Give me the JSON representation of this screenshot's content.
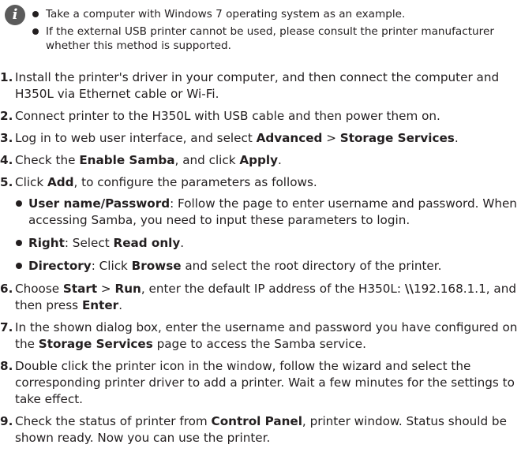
{
  "note": {
    "icon": "info-icon",
    "icon_glyph": "i",
    "items": [
      "Take a computer with Windows 7 operating system as an example.",
      "If the external USB printer cannot be used, please consult the printer manufacturer whether this method is supported."
    ]
  },
  "steps": [
    {
      "num": "1.",
      "text": "Install the printer's driver in your computer, and then connect the computer and H350L via Ethernet cable or Wi-Fi."
    },
    {
      "num": "2.",
      "text": "Connect printer to the H350L with USB cable and then power them on."
    },
    {
      "num": "3.",
      "t1": "Log in to web user interface, and select ",
      "b1": "Advanced",
      "t2": " > ",
      "b2": "Storage Services",
      "t3": "."
    },
    {
      "num": "4.",
      "t1": "Check the ",
      "b1": "Enable Samba",
      "t2": ", and click ",
      "b2": "Apply",
      "t3": "."
    },
    {
      "num": "5.",
      "t1": "Click ",
      "b1": "Add",
      "t2": ", to configure the parameters as follows.",
      "sub": [
        {
          "b1": "User name/Password",
          "t1": ": Follow the page to enter username and password. When accessing Samba, you need to input these parameters to login."
        },
        {
          "b1": "Right",
          "t1": ": Select ",
          "b2": "Read only",
          "t2": "."
        },
        {
          "b1": "Directory",
          "t1": ": Click ",
          "b2": "Browse",
          "t2": " and select the root directory of the printer."
        }
      ]
    },
    {
      "num": "6.",
      "t1": "Choose ",
      "b1": "Start",
      "t2": " > ",
      "b2": "Run",
      "t3": ", enter the default IP address of the H350L: ",
      "b3": "\\\\",
      "t4": "192.168.1.1, and then press ",
      "b4": "Enter",
      "t5": "."
    },
    {
      "num": "7.",
      "t1": "In the shown dialog box, enter the username and password you have configured on the ",
      "b1": "Storage Services",
      "t2": " page to access the Samba service."
    },
    {
      "num": "8.",
      "text": "Double click the printer icon in the window, follow the wizard and select the corresponding printer driver to add a printer. Wait a few minutes for the settings to take effect."
    },
    {
      "num": "9.",
      "t1": "Check the status of printer from ",
      "b1": "Control Panel",
      "t2": ", printer window. Status should be shown ready. Now you can use the printer."
    }
  ]
}
